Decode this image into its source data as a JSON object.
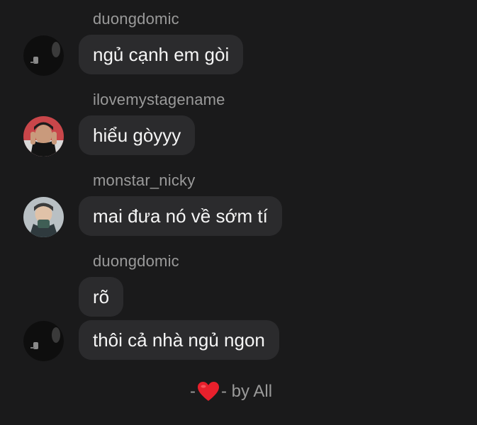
{
  "messages": [
    {
      "sender": "duongdomic",
      "text": "ngủ cạnh em gòi",
      "avatar": "avatar-dark-person"
    },
    {
      "sender": "ilovemystagename",
      "text": "hiểu gòyyy",
      "avatar": "avatar-man-red-background"
    },
    {
      "sender": "monstar_nicky",
      "text": "mai đưa nó về sớm tí",
      "avatar": "avatar-person-cap"
    },
    {
      "sender": "duongdomic",
      "text": "rõ",
      "avatar": ""
    },
    {
      "sender": "",
      "text": "thôi cả nhà ngủ ngon",
      "avatar": "avatar-dark-person"
    }
  ],
  "footer": {
    "prefix": "-",
    "icon": "heart-icon",
    "suffix": "- by All",
    "heart_color": "#e8202c"
  },
  "colors": {
    "background": "#1a1a1b",
    "bubble": "#2b2b2d",
    "sender_text": "#9a9a9a",
    "message_text": "#f5f5f5"
  }
}
